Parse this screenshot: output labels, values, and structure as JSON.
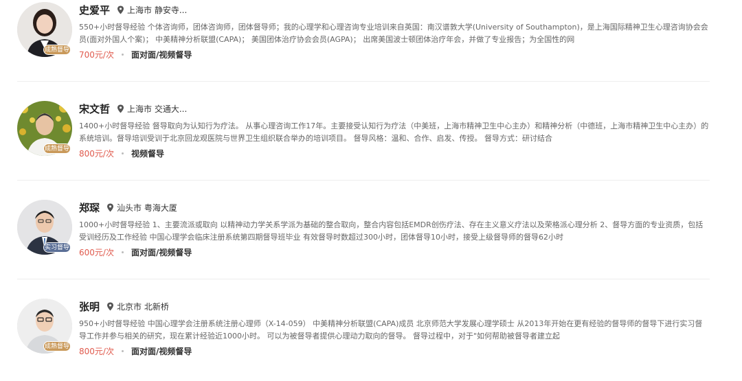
{
  "supervisors": [
    {
      "name": "史爱平",
      "location": "上海市 静安寺...",
      "badge": "成熟督导",
      "description": "550+小时督导经验 个体咨询师，团体咨询师，团体督导师；我的心理学和心理咨询专业培训来自英国：南汉谱敦大学(University of Southampton)，是上海国际精神卫生心理咨询协会会员(面对外国人个案)； 中美精神分析联盟(CAPA)； 美国团体治疗协会会员(AGPA)； 出席美国波士顿团体治疗年会，并做了专业报告；为全国性的网",
      "price": "700元/次",
      "mode": "面对面/视频督导"
    },
    {
      "name": "宋文哲",
      "location": "上海市 交通大...",
      "badge": "成熟督导",
      "description": "1400+小时督导经验 督导取向为认知行为疗法。 从事心理咨询工作17年。主要接受认知行为疗法（中美班，上海市精神卫生中心主办）和精神分析（中德班，上海市精神卫生中心主办）的系统培训。督导培训受训于北京回龙观医院与世界卫生组织联合举办的培训项目。 督导风格：温和、合作、启发、传授。 督导方式：研讨结合",
      "price": "800元/次",
      "mode": "视频督导"
    },
    {
      "name": "郑琛",
      "location": "汕头市 粤海大厦",
      "badge": "实习督导",
      "description": "1000+小时督导经验 1、主要流派或取向 以精神动力学关系学派为基础的整合取向，整合内容包括EMDR创伤疗法、存在主义意义疗法以及荣格派心理分析 2、督导方面的专业资质，包括受训经历及工作经验 中国心理学会临床注册系统第四期督导班毕业 有效督导时数超过300小时，团体督导10小时，接受上级督导师的督导62小时",
      "price": "600元/次",
      "mode": "面对面/视频督导"
    },
    {
      "name": "张明",
      "location": "北京市 北新桥",
      "badge": "成熟督导",
      "description": "950+小时督导经验 中国心理学会注册系统注册心理师（X-14-059） 中美精神分析联盟(CAPA)成员 北京师范大学发展心理学硕士 从2013年开始在更有经验的督导师的督导下进行实习督导工作并参与相关的研究，现在累计经验近1000小时。 可以为被督导者提供心理动力取向的督导。 督导过程中，对于\"如何帮助被督导者建立起",
      "price": "800元/次",
      "mode": "面对面/视频督导"
    }
  ]
}
